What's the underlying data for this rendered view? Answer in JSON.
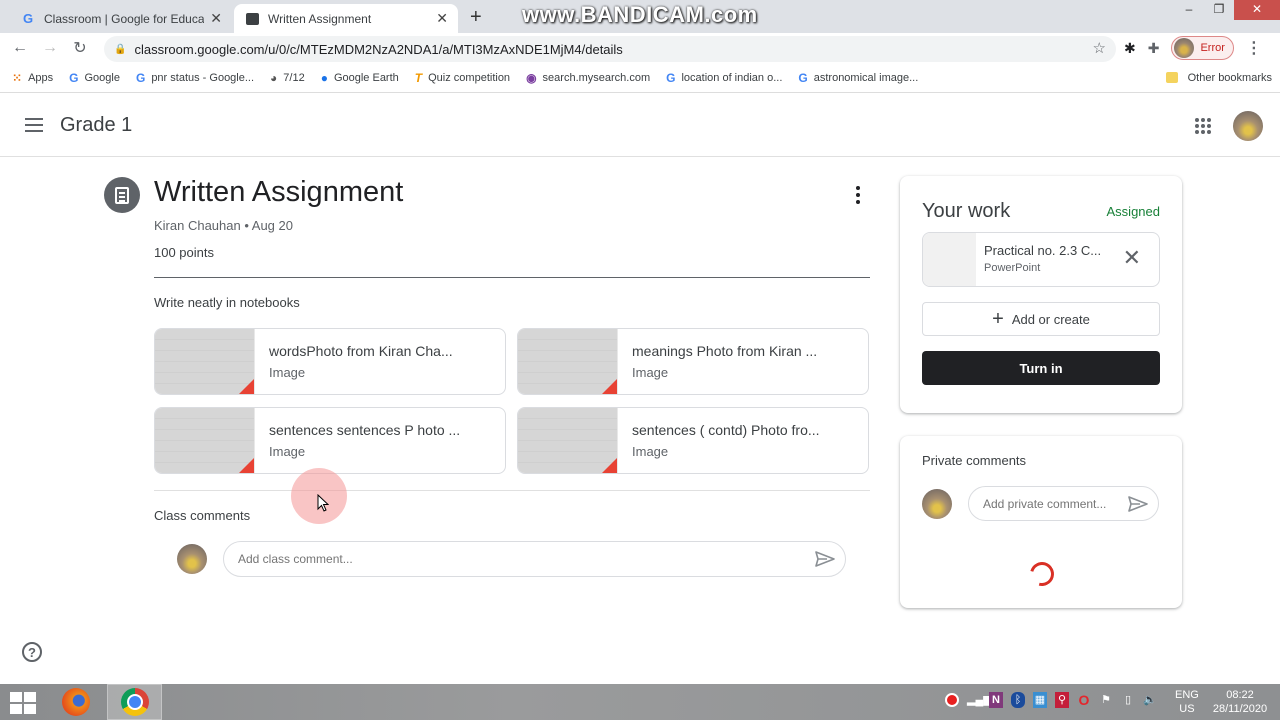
{
  "browser": {
    "tabs": [
      {
        "title": "Classroom | Google for Education",
        "favicon": "google-g-icon"
      },
      {
        "title": "Written Assignment",
        "favicon": "assignment-icon",
        "active": true
      }
    ],
    "watermark": "www.BANDICAM.com",
    "url": "classroom.google.com/u/0/c/MTEzMDM2NzA2NDA1/a/MTI3MzAxNDE1MjM4/details",
    "profile_label": "Error",
    "bookmarks": [
      {
        "label": "Apps",
        "icon": "apps-grid-icon"
      },
      {
        "label": "Google",
        "icon": "google-g-icon"
      },
      {
        "label": "pnr status - Google...",
        "icon": "google-g-icon"
      },
      {
        "label": "7/12",
        "icon": "globe-icon"
      },
      {
        "label": "Google Earth",
        "icon": "google-earth-icon"
      },
      {
        "label": "Quiz competition",
        "icon": "quiz-t-icon"
      },
      {
        "label": "search.mysearch.com",
        "icon": "mysearch-icon"
      },
      {
        "label": "location of indian o...",
        "icon": "google-g-icon"
      },
      {
        "label": "astronomical image...",
        "icon": "google-g-icon"
      }
    ],
    "other_bookmarks": "Other bookmarks"
  },
  "header": {
    "class_name": "Grade 1"
  },
  "assignment": {
    "title": "Written Assignment",
    "meta": "Kiran Chauhan • Aug 20",
    "points": "100 points",
    "description": "Write neatly in notebooks",
    "attachments": [
      {
        "name": "wordsPhoto from Kiran Cha...",
        "type": "Image"
      },
      {
        "name": "meanings Photo from Kiran ...",
        "type": "Image"
      },
      {
        "name": "sentences sentences P hoto ...",
        "type": "Image"
      },
      {
        "name": "sentences ( contd) Photo fro...",
        "type": "Image"
      }
    ]
  },
  "class_comments": {
    "label": "Class comments",
    "placeholder": "Add class comment..."
  },
  "your_work": {
    "title": "Your work",
    "status": "Assigned",
    "status_color": "#188038",
    "file": {
      "name": "Practical no. 2.3 C...",
      "type": "PowerPoint"
    },
    "add_label": "Add or create",
    "turn_in_label": "Turn in"
  },
  "private_comments": {
    "title": "Private comments",
    "placeholder": "Add private comment..."
  },
  "taskbar": {
    "language": "ENG",
    "region": "US",
    "time": "08:22",
    "date": "28/11/2020"
  }
}
